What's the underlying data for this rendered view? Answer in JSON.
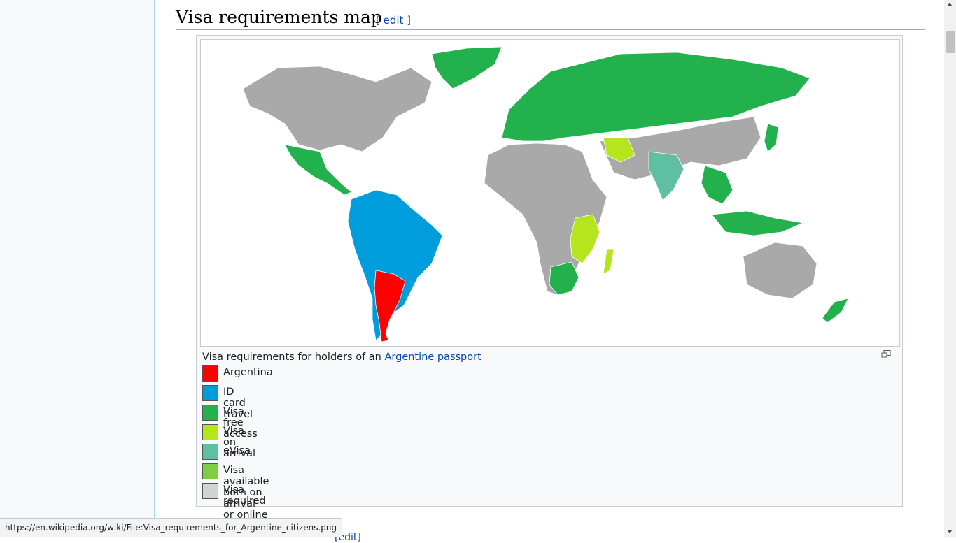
{
  "section": {
    "title": "Visa requirements map",
    "edit_open": "[",
    "edit_label": "edit",
    "edit_close": "]"
  },
  "figure": {
    "caption_prefix": "Visa requirements for holders of an ",
    "caption_link": "Argentine passport",
    "legend": [
      {
        "label": "Argentina",
        "color": "#ff0000"
      },
      {
        "label": "ID card travel",
        "color": "#009ddd"
      },
      {
        "label": "Visa free access",
        "color": "#22b14c"
      },
      {
        "label": "Visa on arrival",
        "color": "#b5e61d"
      },
      {
        "label": "eVisa",
        "color": "#5ec0a0"
      },
      {
        "label": "Visa available both on arrival or online",
        "color": "#7ccf45"
      },
      {
        "label": "Visa required",
        "color": "#d3d3d3"
      }
    ],
    "map_colors": {
      "visa_required": "#a9a9a9",
      "ocean": "#ffffff"
    }
  },
  "status_bar": {
    "url": "https://en.wikipedia.org/wiki/File:Visa_requirements_for_Argentine_citizens.png"
  },
  "next_section": {
    "edit_fragment": "[edit]"
  }
}
